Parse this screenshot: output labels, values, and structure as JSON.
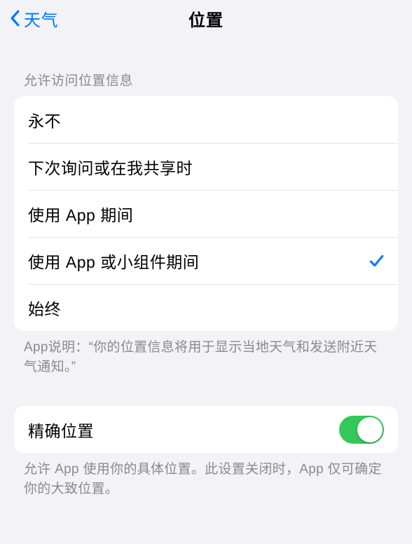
{
  "nav": {
    "back_label": "天气",
    "title": "位置"
  },
  "section1": {
    "header": "允许访问位置信息",
    "options": [
      {
        "label": "永不",
        "selected": false
      },
      {
        "label": "下次询问或在我共享时",
        "selected": false
      },
      {
        "label": "使用 App 期间",
        "selected": false
      },
      {
        "label": "使用 App 或小组件期间",
        "selected": true
      },
      {
        "label": "始终",
        "selected": false
      }
    ],
    "footer": "App说明：“你的位置信息将用于显示当地天气和发送附近天气通知。”"
  },
  "section2": {
    "precise": {
      "label": "精确位置",
      "value": true
    },
    "footer": "允许 App 使用你的具体位置。此设置关闭时，App 仅可确定你的大致位置。"
  }
}
